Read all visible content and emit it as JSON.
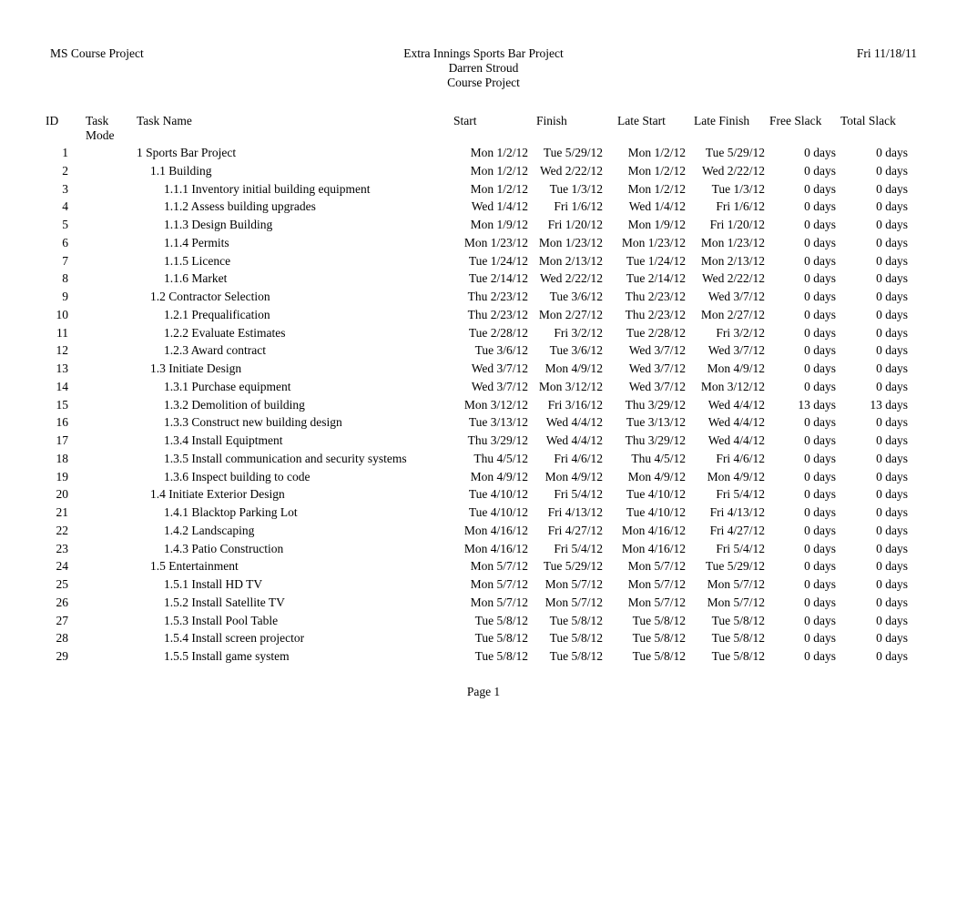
{
  "header": {
    "left": "MS Course Project",
    "center_lines": [
      "Extra Innings Sports Bar Project",
      "Darren Stroud",
      "Course Project"
    ],
    "right": "Fri 11/18/11"
  },
  "columns": {
    "id": "ID",
    "task_mode_line1": "Task",
    "task_mode_line2": "Mode",
    "task_name": "Task Name",
    "start": "Start",
    "finish": "Finish",
    "late_start": "Late Start",
    "late_finish": "Late Finish",
    "free_slack": "Free Slack",
    "total_slack": "Total Slack"
  },
  "footer": {
    "page": "Page 1"
  },
  "rows": [
    {
      "id": "1",
      "mode": "",
      "level": 1,
      "name": "1 Sports Bar Project",
      "start": "Mon 1/2/12",
      "finish": "Tue 5/29/12",
      "late_start": "Mon 1/2/12",
      "late_finish": "Tue 5/29/12",
      "free_slack": "0 days",
      "total_slack": "0 days"
    },
    {
      "id": "2",
      "mode": "",
      "level": 2,
      "name": "1.1 Building",
      "start": "Mon 1/2/12",
      "finish": "Wed 2/22/12",
      "late_start": "Mon 1/2/12",
      "late_finish": "Wed 2/22/12",
      "free_slack": "0 days",
      "total_slack": "0 days"
    },
    {
      "id": "3",
      "mode": "",
      "level": 3,
      "name": "1.1.1 Inventory initial building equipment",
      "start": "Mon 1/2/12",
      "finish": "Tue 1/3/12",
      "late_start": "Mon 1/2/12",
      "late_finish": "Tue 1/3/12",
      "free_slack": "0 days",
      "total_slack": "0 days"
    },
    {
      "id": "4",
      "mode": "",
      "level": 3,
      "name": "1.1.2 Assess building upgrades",
      "start": "Wed 1/4/12",
      "finish": "Fri 1/6/12",
      "late_start": "Wed 1/4/12",
      "late_finish": "Fri 1/6/12",
      "free_slack": "0 days",
      "total_slack": "0 days"
    },
    {
      "id": "5",
      "mode": "",
      "level": 3,
      "name": "1.1.3 Design Building",
      "start": "Mon 1/9/12",
      "finish": "Fri 1/20/12",
      "late_start": "Mon 1/9/12",
      "late_finish": "Fri 1/20/12",
      "free_slack": "0 days",
      "total_slack": "0 days"
    },
    {
      "id": "6",
      "mode": "",
      "level": 3,
      "name": "1.1.4 Permits",
      "start": "Mon 1/23/12",
      "finish": "Mon 1/23/12",
      "late_start": "Mon 1/23/12",
      "late_finish": "Mon 1/23/12",
      "free_slack": "0 days",
      "total_slack": "0 days"
    },
    {
      "id": "7",
      "mode": "",
      "level": 3,
      "name": "1.1.5 Licence",
      "start": "Tue 1/24/12",
      "finish": "Mon 2/13/12",
      "late_start": "Tue 1/24/12",
      "late_finish": "Mon 2/13/12",
      "free_slack": "0 days",
      "total_slack": "0 days"
    },
    {
      "id": "8",
      "mode": "",
      "level": 3,
      "name": "1.1.6 Market",
      "start": "Tue 2/14/12",
      "finish": "Wed 2/22/12",
      "late_start": "Tue 2/14/12",
      "late_finish": "Wed 2/22/12",
      "free_slack": "0 days",
      "total_slack": "0 days"
    },
    {
      "id": "9",
      "mode": "",
      "level": 2,
      "name": "1.2 Contractor Selection",
      "start": "Thu 2/23/12",
      "finish": "Tue 3/6/12",
      "late_start": "Thu 2/23/12",
      "late_finish": "Wed 3/7/12",
      "free_slack": "0 days",
      "total_slack": "0 days"
    },
    {
      "id": "10",
      "mode": "",
      "level": 3,
      "name": "1.2.1 Prequalification",
      "start": "Thu 2/23/12",
      "finish": "Mon 2/27/12",
      "late_start": "Thu 2/23/12",
      "late_finish": "Mon 2/27/12",
      "free_slack": "0 days",
      "total_slack": "0 days"
    },
    {
      "id": "11",
      "mode": "",
      "level": 3,
      "name": "1.2.2 Evaluate Estimates",
      "start": "Tue 2/28/12",
      "finish": "Fri 3/2/12",
      "late_start": "Tue 2/28/12",
      "late_finish": "Fri 3/2/12",
      "free_slack": "0 days",
      "total_slack": "0 days"
    },
    {
      "id": "12",
      "mode": "",
      "level": 3,
      "name": "1.2.3 Award contract",
      "start": "Tue 3/6/12",
      "finish": "Tue 3/6/12",
      "late_start": "Wed 3/7/12",
      "late_finish": "Wed 3/7/12",
      "free_slack": "0 days",
      "total_slack": "0 days"
    },
    {
      "id": "13",
      "mode": "",
      "level": 2,
      "name": "1.3 Initiate Design",
      "start": "Wed 3/7/12",
      "finish": "Mon 4/9/12",
      "late_start": "Wed 3/7/12",
      "late_finish": "Mon 4/9/12",
      "free_slack": "0 days",
      "total_slack": "0 days"
    },
    {
      "id": "14",
      "mode": "",
      "level": 3,
      "name": "1.3.1 Purchase equipment",
      "start": "Wed 3/7/12",
      "finish": "Mon 3/12/12",
      "late_start": "Wed 3/7/12",
      "late_finish": "Mon 3/12/12",
      "free_slack": "0 days",
      "total_slack": "0 days"
    },
    {
      "id": "15",
      "mode": "",
      "level": 3,
      "name": "1.3.2 Demolition of building",
      "start": "Mon 3/12/12",
      "finish": "Fri 3/16/12",
      "late_start": "Thu 3/29/12",
      "late_finish": "Wed 4/4/12",
      "free_slack": "13 days",
      "total_slack": "13 days"
    },
    {
      "id": "16",
      "mode": "",
      "level": 3,
      "name": "1.3.3 Construct new building design",
      "start": "Tue 3/13/12",
      "finish": "Wed 4/4/12",
      "late_start": "Tue 3/13/12",
      "late_finish": "Wed 4/4/12",
      "free_slack": "0 days",
      "total_slack": "0 days"
    },
    {
      "id": "17",
      "mode": "",
      "level": 3,
      "name": "1.3.4 Install Equiptment",
      "start": "Thu 3/29/12",
      "finish": "Wed 4/4/12",
      "late_start": "Thu 3/29/12",
      "late_finish": "Wed 4/4/12",
      "free_slack": "0 days",
      "total_slack": "0 days"
    },
    {
      "id": "18",
      "mode": "",
      "level": 3,
      "name": "1.3.5 Install communication and security systems",
      "start": "Thu 4/5/12",
      "finish": "Fri 4/6/12",
      "late_start": "Thu 4/5/12",
      "late_finish": "Fri 4/6/12",
      "free_slack": "0 days",
      "total_slack": "0 days"
    },
    {
      "id": "19",
      "mode": "",
      "level": 3,
      "name": "1.3.6 Inspect building to code",
      "start": "Mon 4/9/12",
      "finish": "Mon 4/9/12",
      "late_start": "Mon 4/9/12",
      "late_finish": "Mon 4/9/12",
      "free_slack": "0 days",
      "total_slack": "0 days"
    },
    {
      "id": "20",
      "mode": "",
      "level": 2,
      "name": "1.4 Initiate Exterior Design",
      "start": "Tue 4/10/12",
      "finish": "Fri 5/4/12",
      "late_start": "Tue 4/10/12",
      "late_finish": "Fri 5/4/12",
      "free_slack": "0 days",
      "total_slack": "0 days"
    },
    {
      "id": "21",
      "mode": "",
      "level": 3,
      "name": "1.4.1 Blacktop Parking Lot",
      "start": "Tue 4/10/12",
      "finish": "Fri 4/13/12",
      "late_start": "Tue 4/10/12",
      "late_finish": "Fri 4/13/12",
      "free_slack": "0 days",
      "total_slack": "0 days"
    },
    {
      "id": "22",
      "mode": "",
      "level": 3,
      "name": "1.4.2 Landscaping",
      "start": "Mon 4/16/12",
      "finish": "Fri 4/27/12",
      "late_start": "Mon 4/16/12",
      "late_finish": "Fri 4/27/12",
      "free_slack": "0 days",
      "total_slack": "0 days"
    },
    {
      "id": "23",
      "mode": "",
      "level": 3,
      "name": "1.4.3 Patio Construction",
      "start": "Mon 4/16/12",
      "finish": "Fri 5/4/12",
      "late_start": "Mon 4/16/12",
      "late_finish": "Fri 5/4/12",
      "free_slack": "0 days",
      "total_slack": "0 days"
    },
    {
      "id": "24",
      "mode": "",
      "level": 2,
      "name": "1.5 Entertainment",
      "start": "Mon 5/7/12",
      "finish": "Tue 5/29/12",
      "late_start": "Mon 5/7/12",
      "late_finish": "Tue 5/29/12",
      "free_slack": "0 days",
      "total_slack": "0 days"
    },
    {
      "id": "25",
      "mode": "",
      "level": 3,
      "name": "1.5.1 Install HD TV",
      "start": "Mon 5/7/12",
      "finish": "Mon 5/7/12",
      "late_start": "Mon 5/7/12",
      "late_finish": "Mon 5/7/12",
      "free_slack": "0 days",
      "total_slack": "0 days"
    },
    {
      "id": "26",
      "mode": "",
      "level": 3,
      "name": "1.5.2 Install Satellite TV",
      "start": "Mon 5/7/12",
      "finish": "Mon 5/7/12",
      "late_start": "Mon 5/7/12",
      "late_finish": "Mon 5/7/12",
      "free_slack": "0 days",
      "total_slack": "0 days"
    },
    {
      "id": "27",
      "mode": "",
      "level": 3,
      "name": "1.5.3 Install Pool Table",
      "start": "Tue 5/8/12",
      "finish": "Tue 5/8/12",
      "late_start": "Tue 5/8/12",
      "late_finish": "Tue 5/8/12",
      "free_slack": "0 days",
      "total_slack": "0 days"
    },
    {
      "id": "28",
      "mode": "",
      "level": 3,
      "name": "1.5.4 Install screen projector",
      "start": "Tue 5/8/12",
      "finish": "Tue 5/8/12",
      "late_start": "Tue 5/8/12",
      "late_finish": "Tue 5/8/12",
      "free_slack": "0 days",
      "total_slack": "0 days"
    },
    {
      "id": "29",
      "mode": "",
      "level": 3,
      "name": "1.5.5 Install game system",
      "start": "Tue 5/8/12",
      "finish": "Tue 5/8/12",
      "late_start": "Tue 5/8/12",
      "late_finish": "Tue 5/8/12",
      "free_slack": "0 days",
      "total_slack": "0 days"
    }
  ]
}
